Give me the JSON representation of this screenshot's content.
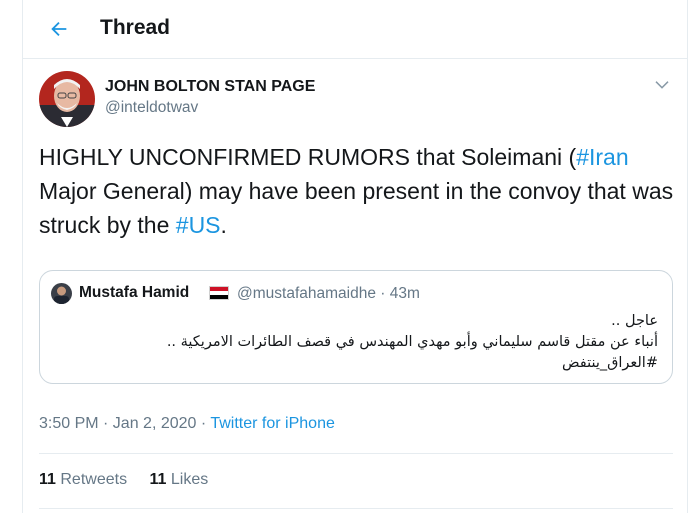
{
  "header": {
    "title": "Thread",
    "back_icon": "arrow-left-icon"
  },
  "tweet": {
    "author_name": "JOHN BOLTON STAN PAGE",
    "author_handle": "@inteldotwav",
    "text_parts": {
      "p1": "HIGHLY UNCONFIRMED RUMORS that Soleimani (",
      "tag1": "#Iran",
      "p2": " Major General) may have been present in the convoy that was struck by the ",
      "tag2": "#US",
      "p3": "."
    },
    "timestamp": "3:50 PM · Jan 2, 2020 · ",
    "source": "Twitter for iPhone",
    "retweets_count": "11",
    "retweets_label": "Retweets",
    "likes_count": "11",
    "likes_label": "Likes"
  },
  "quoted": {
    "name": "Mustafa Hamid",
    "handle_time": "@mustafahamaidhe · 43m",
    "lines": [
      "عاجل ..",
      "أنباء عن مقتل قاسم سليماني وأبو مهدي المهندس في قصف الطائرات الامريكية ..",
      "#العراق_ينتفض"
    ]
  },
  "colors": {
    "accent": "#1b95e0",
    "muted": "#657786",
    "text": "#14171a",
    "border": "#e6ecf0"
  }
}
